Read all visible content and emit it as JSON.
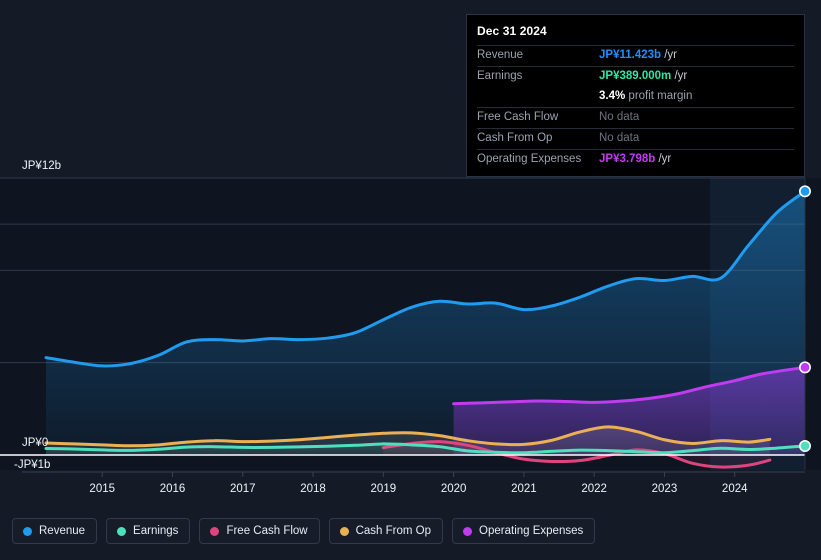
{
  "tooltip": {
    "date": "Dec 31 2024",
    "rows": [
      {
        "label": "Revenue",
        "value": "JP¥11.423b",
        "unit": "/yr",
        "color": "#1f8fff",
        "nodata": false
      },
      {
        "label": "Earnings",
        "value": "JP¥389.000m",
        "unit": "/yr",
        "color": "#2ee6a8",
        "nodata": false
      },
      {
        "label": "",
        "value": "3.4%",
        "unit": "profit margin",
        "color": "#ffffff",
        "nodata": false,
        "margin": true
      },
      {
        "label": "Free Cash Flow",
        "value": "No data",
        "unit": "",
        "color": "#6e7580",
        "nodata": true
      },
      {
        "label": "Cash From Op",
        "value": "No data",
        "unit": "",
        "color": "#6e7580",
        "nodata": true
      },
      {
        "label": "Operating Expenses",
        "value": "JP¥3.798b",
        "unit": "/yr",
        "color": "#c13cf0",
        "nodata": false
      }
    ]
  },
  "yaxis": {
    "top_label": "JP¥12b",
    "zero_label": "JP¥0",
    "bottom_label": "-JP¥1b"
  },
  "legend": [
    {
      "label": "Revenue",
      "color": "#1f9bf0"
    },
    {
      "label": "Earnings",
      "color": "#4ee0bd"
    },
    {
      "label": "Free Cash Flow",
      "color": "#e0447f"
    },
    {
      "label": "Cash From Op",
      "color": "#eab054"
    },
    {
      "label": "Operating Expenses",
      "color": "#c13cf0"
    }
  ],
  "chart_data": {
    "type": "area",
    "title": "",
    "xlabel": "",
    "ylabel": "",
    "currency": "JP¥",
    "ylim": [
      -1,
      12
    ],
    "y_unit": "b",
    "grid": true,
    "legend_position": "bottom",
    "x_tick_labels": [
      "2015",
      "2016",
      "2017",
      "2018",
      "2019",
      "2020",
      "2021",
      "2022",
      "2023",
      "2024"
    ],
    "x_tick_values": [
      2015,
      2016,
      2017,
      2018,
      2019,
      2020,
      2021,
      2022,
      2023,
      2024
    ],
    "x_range": [
      2014.2,
      2025.0
    ],
    "y_gridlines": [
      12,
      10,
      8,
      4,
      0
    ],
    "highlight_band": {
      "from": 2023.65,
      "to": 2025.0
    },
    "series": [
      {
        "name": "Revenue",
        "color": "#1f9bf0",
        "x": [
          2014.2,
          2014.6,
          2015.0,
          2015.4,
          2015.8,
          2016.2,
          2016.6,
          2017.0,
          2017.4,
          2017.8,
          2018.2,
          2018.6,
          2019.0,
          2019.4,
          2019.8,
          2020.2,
          2020.6,
          2021.0,
          2021.4,
          2021.8,
          2022.2,
          2022.6,
          2023.0,
          2023.4,
          2023.8,
          2024.2,
          2024.6,
          2025.0
        ],
        "values": [
          4.22,
          4.02,
          3.86,
          3.96,
          4.32,
          4.9,
          5.0,
          4.94,
          5.04,
          5.0,
          5.06,
          5.3,
          5.86,
          6.4,
          6.66,
          6.54,
          6.58,
          6.3,
          6.46,
          6.84,
          7.32,
          7.64,
          7.56,
          7.74,
          7.66,
          9.1,
          10.5,
          11.423
        ]
      },
      {
        "name": "Earnings",
        "color": "#4ee0bd",
        "x": [
          2014.2,
          2014.6,
          2015.0,
          2015.4,
          2015.8,
          2016.2,
          2016.6,
          2017.0,
          2017.4,
          2017.8,
          2018.2,
          2018.6,
          2019.0,
          2019.4,
          2019.8,
          2020.2,
          2020.6,
          2021.0,
          2021.4,
          2021.8,
          2022.2,
          2022.6,
          2023.0,
          2023.4,
          2023.8,
          2024.2,
          2024.6,
          2025.0
        ],
        "values": [
          0.28,
          0.26,
          0.22,
          0.2,
          0.25,
          0.34,
          0.36,
          0.33,
          0.33,
          0.35,
          0.38,
          0.42,
          0.48,
          0.44,
          0.36,
          0.18,
          0.12,
          0.1,
          0.16,
          0.21,
          0.19,
          0.14,
          0.1,
          0.19,
          0.29,
          0.24,
          0.3,
          0.389
        ]
      },
      {
        "name": "Free Cash Flow",
        "color": "#e0447f",
        "x": [
          2019.0,
          2019.4,
          2019.8,
          2020.2,
          2020.6,
          2021.0,
          2021.4,
          2021.8,
          2022.2,
          2022.6,
          2023.0,
          2023.4,
          2023.8,
          2024.2,
          2024.5
        ],
        "values": [
          0.32,
          0.5,
          0.58,
          0.42,
          0.1,
          -0.18,
          -0.28,
          -0.24,
          -0.02,
          0.22,
          0.06,
          -0.36,
          -0.52,
          -0.44,
          -0.22
        ]
      },
      {
        "name": "Cash From Op",
        "color": "#eab054",
        "x": [
          2014.2,
          2014.6,
          2015.0,
          2015.4,
          2015.8,
          2016.2,
          2016.6,
          2017.0,
          2017.4,
          2017.8,
          2018.2,
          2018.6,
          2019.0,
          2019.4,
          2019.8,
          2020.2,
          2020.6,
          2021.0,
          2021.4,
          2021.8,
          2022.2,
          2022.6,
          2023.0,
          2023.4,
          2023.8,
          2024.2,
          2024.5
        ],
        "values": [
          0.52,
          0.48,
          0.44,
          0.4,
          0.44,
          0.56,
          0.62,
          0.58,
          0.6,
          0.66,
          0.76,
          0.86,
          0.94,
          0.96,
          0.84,
          0.62,
          0.48,
          0.46,
          0.64,
          1.0,
          1.22,
          1.02,
          0.66,
          0.5,
          0.62,
          0.56,
          0.68
        ]
      },
      {
        "name": "Operating Expenses",
        "color": "#c13cf0",
        "x": [
          2020.0,
          2020.4,
          2020.8,
          2021.2,
          2021.6,
          2022.0,
          2022.4,
          2022.8,
          2023.2,
          2023.6,
          2024.0,
          2024.4,
          2025.0
        ],
        "values": [
          2.22,
          2.26,
          2.3,
          2.34,
          2.32,
          2.28,
          2.34,
          2.46,
          2.66,
          2.96,
          3.22,
          3.52,
          3.798
        ]
      }
    ],
    "end_markers": [
      {
        "name": "Revenue",
        "x": 2025.0,
        "value": 11.423,
        "color": "#1f9bf0"
      },
      {
        "name": "Operating Expenses",
        "x": 2025.0,
        "value": 3.798,
        "color": "#c13cf0"
      },
      {
        "name": "Earnings",
        "x": 2025.0,
        "value": 0.389,
        "color": "#4ee0bd"
      }
    ]
  }
}
